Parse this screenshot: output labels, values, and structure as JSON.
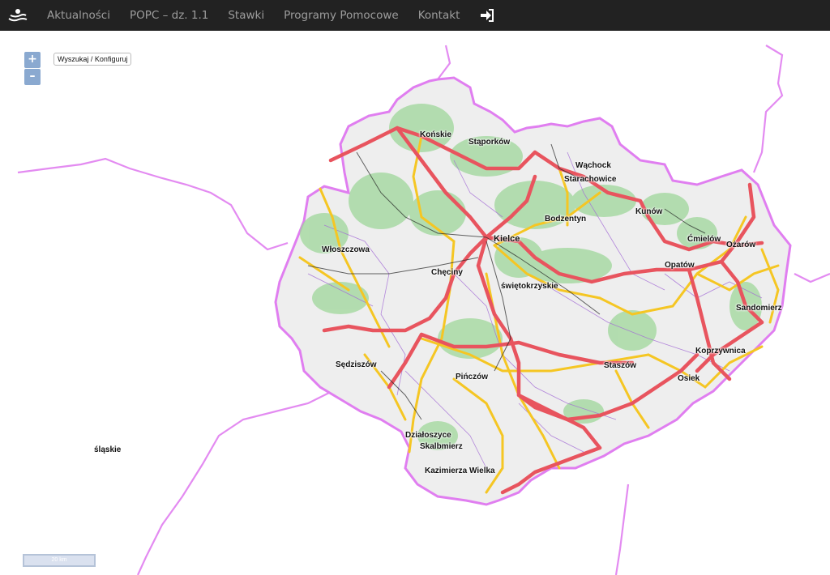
{
  "nav": {
    "logo_icon": "hands-logo-icon",
    "items": [
      "Aktualności",
      "POPC – dz. 1.1",
      "Stawki",
      "Programy Pomocowe",
      "Kontakt"
    ],
    "login_icon": "sign-in-icon"
  },
  "map": {
    "zoom_in": "+",
    "zoom_out": "–",
    "search_button": "Wyszukaj / Konfiguruj",
    "scale_label": "20 km",
    "neighbor_region": "śląskie",
    "cities": [
      "Końskie",
      "Stąporków",
      "Wąchock",
      "Starachowice",
      "Bodzentyn",
      "Kunów",
      "Ćmielów",
      "Ożarów",
      "Kielce",
      "Włoszczowa",
      "Chęciny",
      "świętokrzyskie",
      "Opatów",
      "Sandomierz",
      "Koprzywnica",
      "Staszów",
      "Osiek",
      "Sędziszów",
      "Pińczów",
      "Działoszyce",
      "Skalbmierz",
      "Kazimierza Wielka"
    ]
  },
  "colors": {
    "navbar": "#222222",
    "nav_text": "#9d9d9d",
    "border": "#e07ef0",
    "expressway": "#e8545e",
    "main_road": "#f5c623",
    "forest": "#9fd79a"
  }
}
